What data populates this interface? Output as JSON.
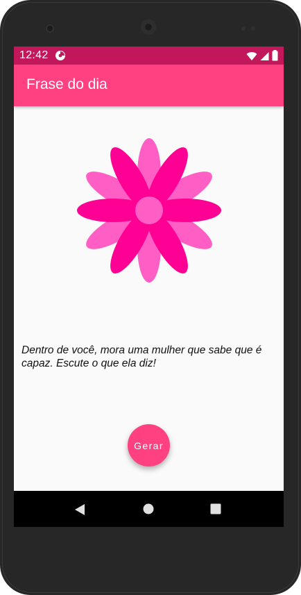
{
  "status_bar": {
    "time": "12:42",
    "color": "#c2185b",
    "icons": [
      "notification-icon",
      "wifi-icon",
      "signal-icon",
      "battery-icon"
    ]
  },
  "app_bar": {
    "title": "Frase do dia",
    "color": "#ff4081"
  },
  "content": {
    "image": "flower-icon",
    "quote": "Dentro de você, mora uma mulher que sabe que é capaz. Escute o que ela diz!",
    "button_label": "Gerar"
  },
  "nav_bar": {
    "icons": [
      "back-icon",
      "home-icon",
      "recents-icon"
    ]
  },
  "colors": {
    "accent": "#ff4081",
    "flower_dark": "#ff0094",
    "flower_light": "#ff5ec4",
    "background": "#fafafa"
  }
}
